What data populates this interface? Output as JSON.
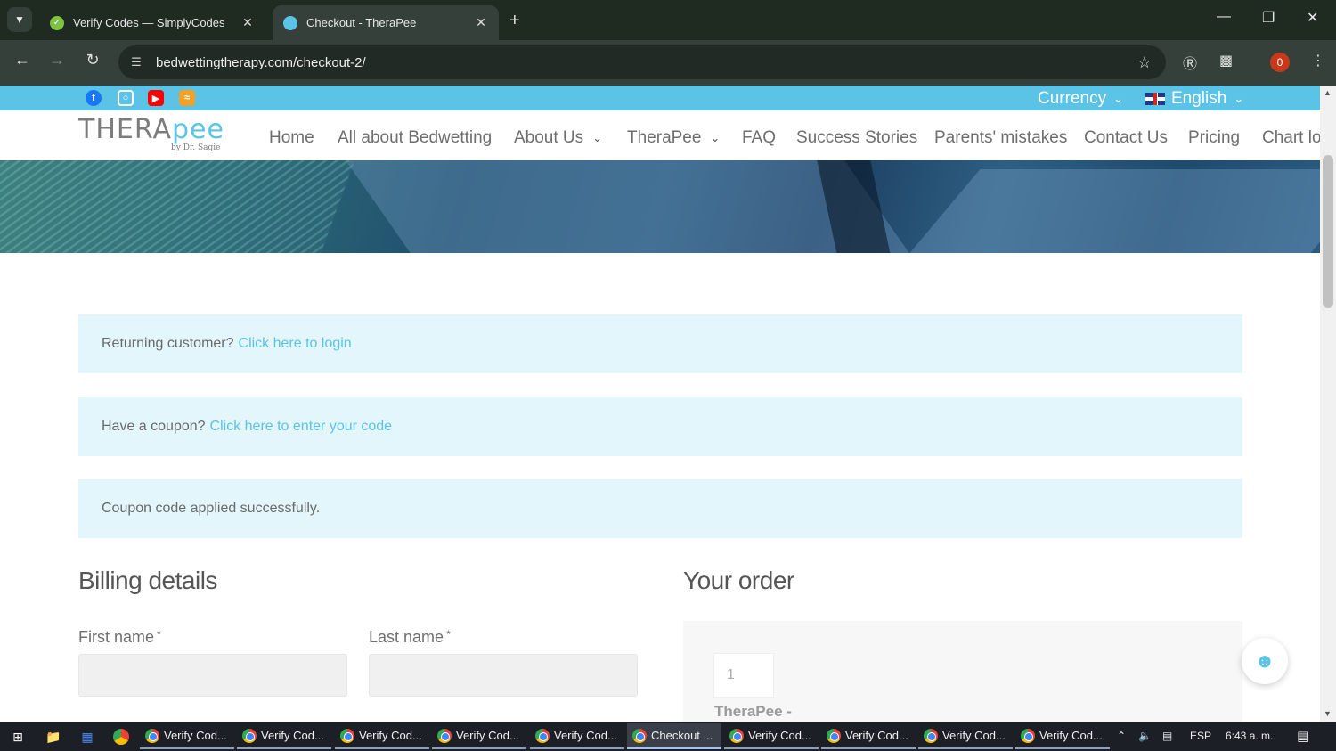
{
  "browser": {
    "tabs": [
      {
        "title": "Verify Codes — SimplyCodes",
        "active": false
      },
      {
        "title": "Checkout - TheraPee",
        "active": true
      }
    ],
    "url": "bedwettingtherapy.com/checkout-2/",
    "profile_badge": "0"
  },
  "site": {
    "topbar": {
      "social_icons": [
        "facebook-icon",
        "instagram-icon",
        "youtube-icon",
        "rss-icon"
      ],
      "currency_label": "Currency",
      "language_label": "English"
    },
    "logo": {
      "text_gray": "THERA",
      "text_blue": "pee",
      "sub": "by Dr. Sagie"
    },
    "nav": [
      {
        "label": "Home",
        "has_dropdown": false
      },
      {
        "label": "All about Bedwetting",
        "has_dropdown": false
      },
      {
        "label": "About Us",
        "has_dropdown": true
      },
      {
        "label": "TheraPee",
        "has_dropdown": true
      },
      {
        "label": "FAQ",
        "has_dropdown": false
      },
      {
        "label": "Success Stories",
        "has_dropdown": false
      },
      {
        "label": "Parents' mistakes",
        "has_dropdown": false
      },
      {
        "label": "Contact Us",
        "has_dropdown": false
      },
      {
        "label": "Pricing",
        "has_dropdown": false
      },
      {
        "label": "Chart lo",
        "has_dropdown": false
      }
    ]
  },
  "checkout": {
    "returning": {
      "text": "Returning customer?",
      "link": "Click here to login"
    },
    "coupon": {
      "text": "Have a coupon?",
      "link": "Click here to enter your code"
    },
    "applied": {
      "text": "Coupon code applied successfully."
    },
    "billing_title": "Billing details",
    "order_title": "Your order",
    "first_name_label": "First name",
    "last_name_label": "Last name",
    "required_mark": "*",
    "order": {
      "quantity": "1",
      "product": "TheraPee -"
    }
  },
  "taskbar": {
    "tasks": [
      {
        "label": "Verify Cod...",
        "active": false
      },
      {
        "label": "Verify Cod...",
        "active": false
      },
      {
        "label": "Verify Cod...",
        "active": false
      },
      {
        "label": "Verify Cod...",
        "active": false
      },
      {
        "label": "Verify Cod...",
        "active": false
      },
      {
        "label": "Checkout ...",
        "active": true
      },
      {
        "label": "Verify Cod...",
        "active": false
      },
      {
        "label": "Verify Cod...",
        "active": false
      },
      {
        "label": "Verify Cod...",
        "active": false
      },
      {
        "label": "Verify Cod...",
        "active": false
      }
    ],
    "language": "ESP",
    "time": "6:43 a. m."
  },
  "colors": {
    "accent": "#5bc3e6",
    "notice_bg": "#e3f6fb",
    "chrome_dark": "#1f2a21"
  }
}
